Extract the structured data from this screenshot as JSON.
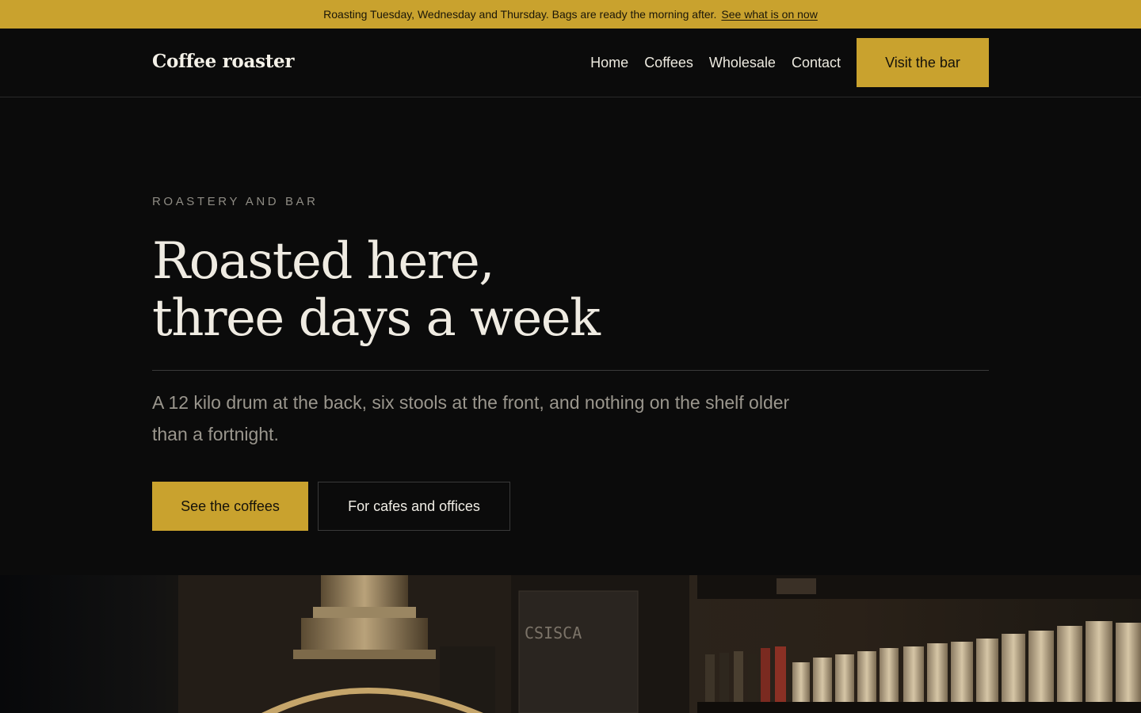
{
  "announcement": {
    "message": "Roasting Tuesday, Wednesday and Thursday. Bags are ready the morning after.",
    "link": "See what is on now"
  },
  "header": {
    "logo": "Coffee roaster",
    "nav": [
      "Home",
      "Coffees",
      "Wholesale",
      "Contact"
    ],
    "cta": "Visit the bar"
  },
  "hero": {
    "eyebrow": "ROASTERY AND BAR",
    "headline_line1": "Roasted here,",
    "headline_line2": "three days a week",
    "lede": "A 12 kilo drum at the back, six stools at the front, and nothing on the shelf older than a fortnight.",
    "primary_button": "See the coffees",
    "secondary_button": "For cafes and offices"
  },
  "colors": {
    "accent": "#c9a22e",
    "background": "#0b0b0b",
    "text": "#efebe2",
    "muted": "#9a968d"
  },
  "photo": {
    "sign_text": "CSISCA"
  }
}
